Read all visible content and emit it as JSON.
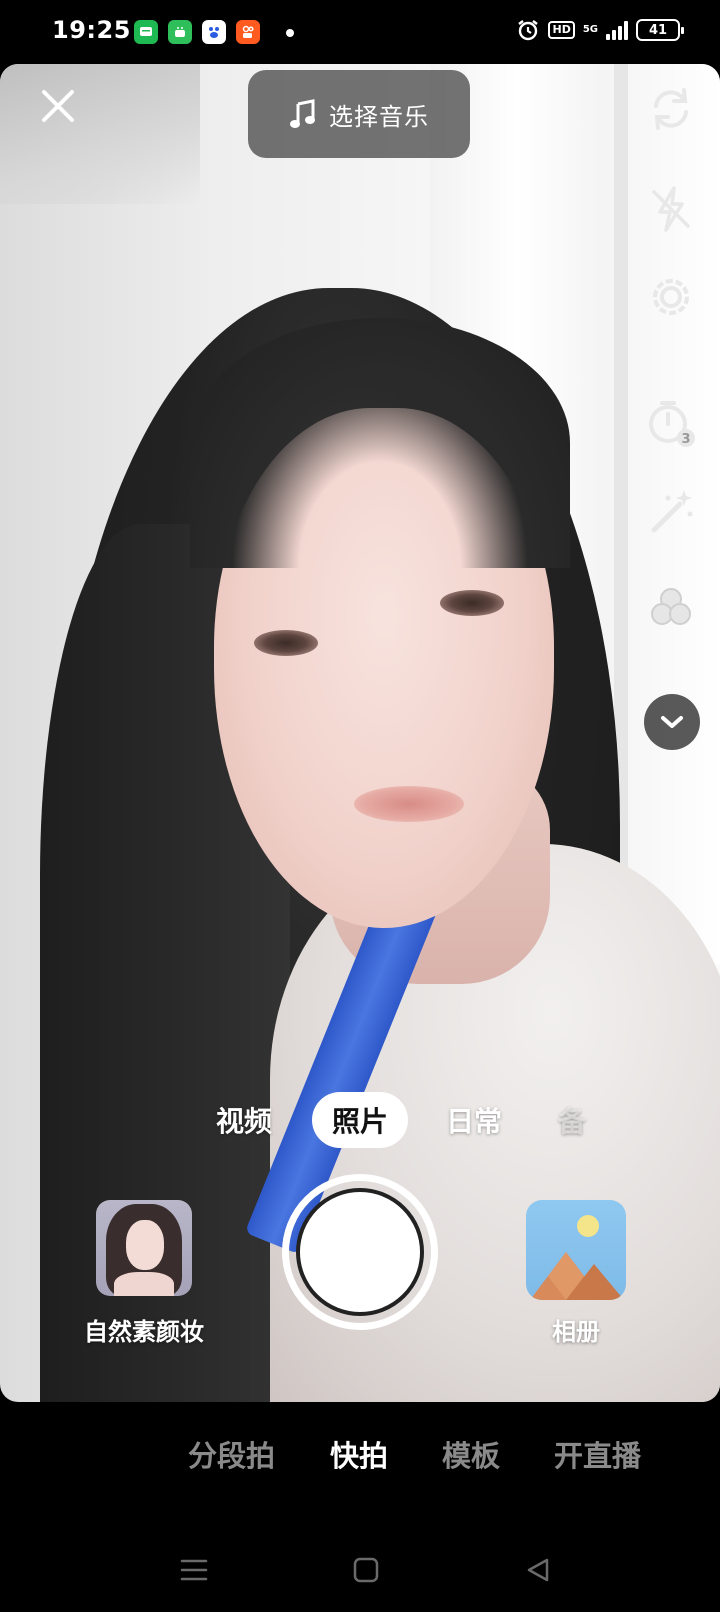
{
  "status_bar": {
    "time": "19:25",
    "hd": "HD",
    "network": "5G",
    "battery": "41",
    "app_icons": [
      "messages-app-icon",
      "android-app-icon",
      "baidu-app-icon",
      "kuaishou-app-icon"
    ]
  },
  "top": {
    "music_label": "选择音乐"
  },
  "right_toolbar": [
    "flip-camera-icon",
    "flash-off-icon",
    "settings-icon",
    "timer-3s-icon",
    "beauty-wand-icon",
    "filter-icon",
    "expand-more-icon"
  ],
  "capture_modes": {
    "items": [
      "视频",
      "照片",
      "日常",
      "备"
    ],
    "selected": "照片"
  },
  "beauty": {
    "label": "自然素颜妆"
  },
  "album": {
    "label": "相册"
  },
  "bottom_tabs": {
    "items": [
      "分段拍",
      "快拍",
      "模板",
      "开直播"
    ],
    "selected": "快拍"
  },
  "nav_bar": [
    "menu-nav-icon",
    "home-nav-icon",
    "back-nav-icon"
  ],
  "colors": {
    "lanyard": "#3b66d6",
    "active_pill": "#ffffff",
    "inactive_tab": "#8a8a8a"
  }
}
